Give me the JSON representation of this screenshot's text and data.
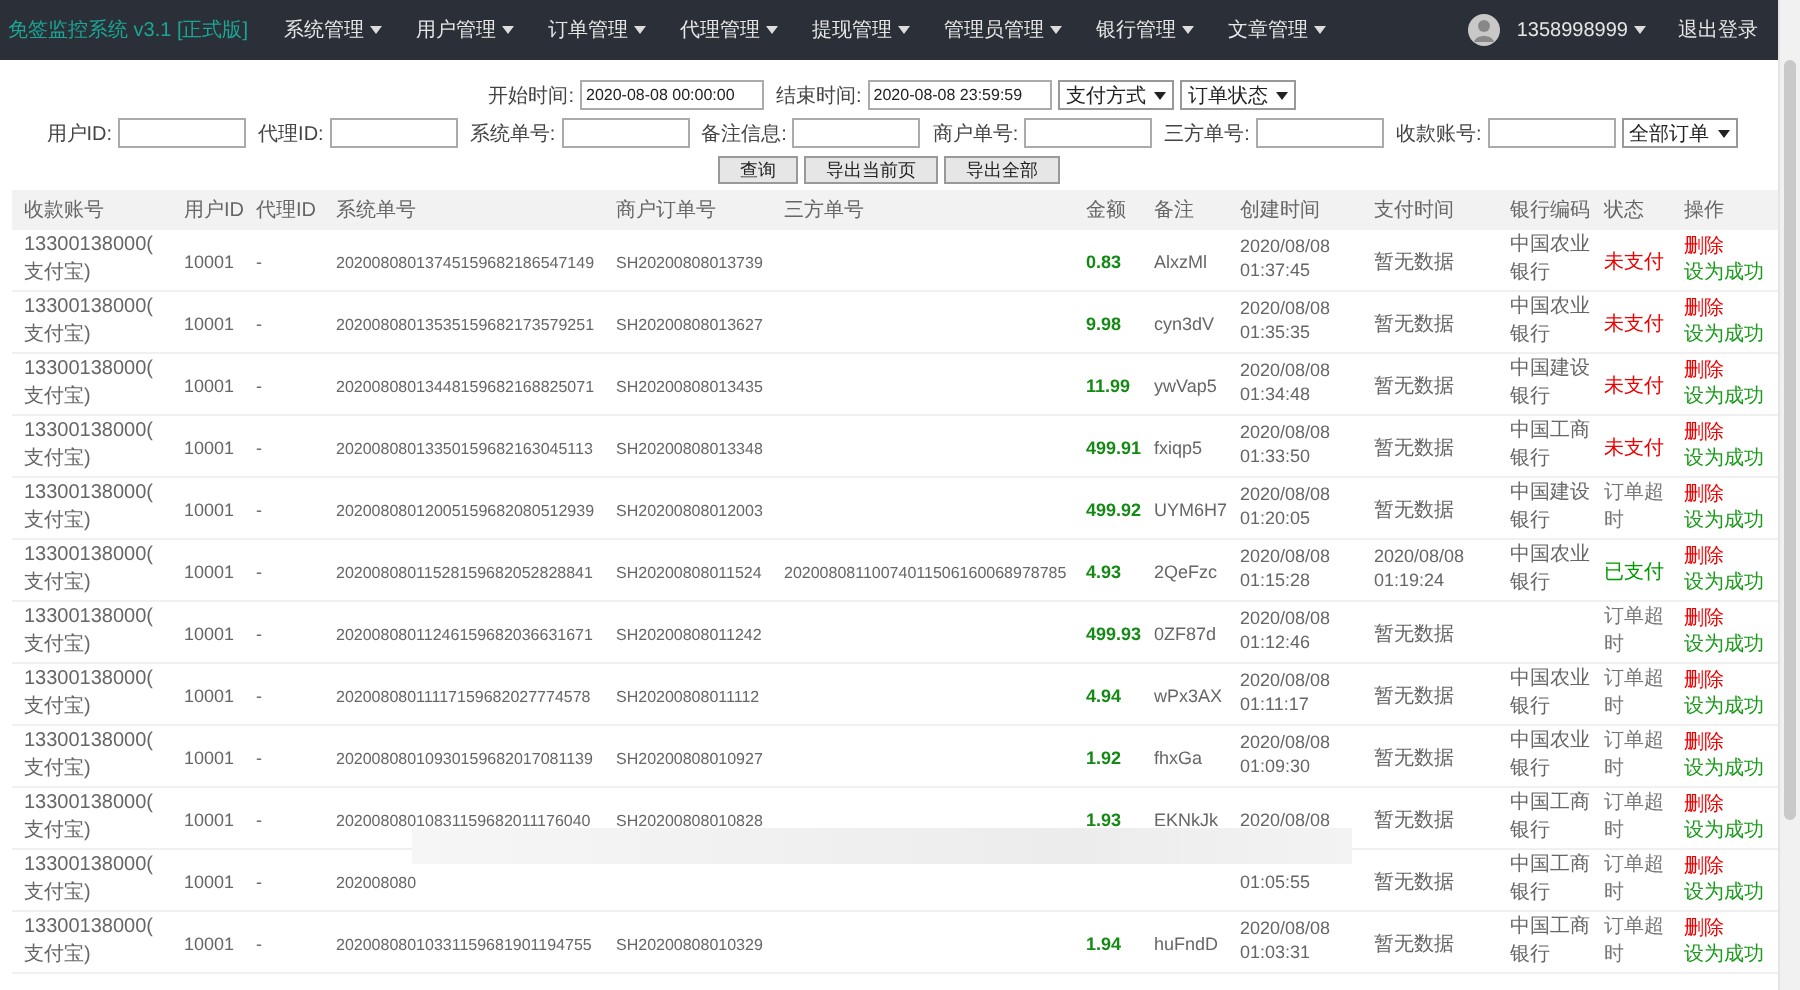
{
  "header": {
    "title": "免签监控系统 v3.1 [正式版]",
    "menu": [
      {
        "label": "系统管理"
      },
      {
        "label": "用户管理"
      },
      {
        "label": "订单管理"
      },
      {
        "label": "代理管理"
      },
      {
        "label": "提现管理"
      },
      {
        "label": "管理员管理"
      },
      {
        "label": "银行管理"
      },
      {
        "label": "文章管理"
      }
    ],
    "user": "1358998999",
    "logout": "退出登录"
  },
  "filters": {
    "row1": [
      {
        "kind": "input",
        "label": "开始时间:",
        "value": "2020-08-08 00:00:00"
      },
      {
        "kind": "input",
        "label": "结束时间:",
        "value": "2020-08-08 23:59:59"
      },
      {
        "kind": "select",
        "value": "支付方式"
      },
      {
        "kind": "select",
        "value": "订单状态"
      }
    ],
    "row2": [
      {
        "kind": "input",
        "label": "用户ID:"
      },
      {
        "kind": "input",
        "label": "代理ID:"
      },
      {
        "kind": "input",
        "label": "系统单号:"
      },
      {
        "kind": "input",
        "label": "备注信息:"
      },
      {
        "kind": "input",
        "label": "商户单号:"
      },
      {
        "kind": "input",
        "label": "三方单号:"
      },
      {
        "kind": "input",
        "label": "收款账号:"
      },
      {
        "kind": "select",
        "value": "全部订单"
      }
    ],
    "buttons": [
      "查询",
      "导出当前页",
      "导出全部"
    ]
  },
  "table": {
    "columns": [
      "收款账号",
      "用户ID",
      "代理ID",
      "系统单号",
      "商户订单号",
      "三方单号",
      "金额",
      "备注",
      "创建时间",
      "支付时间",
      "银行编码",
      "状态",
      "操作"
    ],
    "rows": [
      {
        "account": "13300138000(支付宝)",
        "user_id": "10001",
        "agent_id": "-",
        "sys_no": "20200808013745159682186547149",
        "merchant_no": "SH20200808013739",
        "amount": "0.83",
        "remark": "AlxzMl",
        "created": "2020/08/08 01:37:45",
        "paid": "暂无数据",
        "bank": "中国农业银行",
        "status": {
          "label": "未支付",
          "kind": "unpaid"
        },
        "actions": [
          "删除",
          "设为成功"
        ]
      },
      {
        "account": "13300138000(支付宝)",
        "user_id": "10001",
        "agent_id": "-",
        "sys_no": "20200808013535159682173579251",
        "merchant_no": "SH20200808013627",
        "amount": "9.98",
        "remark": "cyn3dV",
        "created": "2020/08/08 01:35:35",
        "paid": "暂无数据",
        "bank": "中国农业银行",
        "status": {
          "label": "未支付",
          "kind": "unpaid"
        },
        "actions": [
          "删除",
          "设为成功"
        ]
      },
      {
        "account": "13300138000(支付宝)",
        "user_id": "10001",
        "agent_id": "-",
        "sys_no": "20200808013448159682168825071",
        "merchant_no": "SH20200808013435",
        "amount": "11.99",
        "remark": "ywVap5",
        "created": "2020/08/08 01:34:48",
        "paid": "暂无数据",
        "bank": "中国建设银行",
        "status": {
          "label": "未支付",
          "kind": "unpaid"
        },
        "actions": [
          "删除",
          "设为成功"
        ]
      },
      {
        "account": "13300138000(支付宝)",
        "user_id": "10001",
        "agent_id": "-",
        "sys_no": "20200808013350159682163045113",
        "merchant_no": "SH20200808013348",
        "amount": "499.91",
        "remark": "fxiqp5",
        "created": "2020/08/08 01:33:50",
        "paid": "暂无数据",
        "bank": "中国工商银行",
        "status": {
          "label": "未支付",
          "kind": "unpaid"
        },
        "actions": [
          "删除",
          "设为成功"
        ]
      },
      {
        "account": "13300138000(支付宝)",
        "user_id": "10001",
        "agent_id": "-",
        "sys_no": "20200808012005159682080512939",
        "merchant_no": "SH20200808012003",
        "amount": "499.92",
        "remark": "UYM6H7",
        "created": "2020/08/08 01:20:05",
        "paid": "暂无数据",
        "bank": "中国建设银行",
        "status": {
          "label": "订单超时",
          "kind": "timeout"
        },
        "actions": [
          "删除",
          "设为成功"
        ]
      },
      {
        "account": "13300138000(支付宝)",
        "user_id": "10001",
        "agent_id": "-",
        "sys_no": "20200808011528159682052828841",
        "merchant_no": "SH20200808011524",
        "third_no": "20200808110074011506160068978785",
        "amount": "4.93",
        "remark": "2QeFzc",
        "created": "2020/08/08 01:15:28",
        "paid": "2020/08/08 01:19:24",
        "bank": "中国农业银行",
        "status": {
          "label": "已支付",
          "kind": "paid"
        },
        "actions": [
          "删除",
          "设为成功"
        ]
      },
      {
        "account": "13300138000(支付宝)",
        "user_id": "10001",
        "agent_id": "-",
        "sys_no": "20200808011246159682036631671",
        "merchant_no": "SH20200808011242",
        "amount": "499.93",
        "remark": "0ZF87d",
        "created": "2020/08/08 01:12:46",
        "paid": "暂无数据",
        "status": {
          "label": "订单超时",
          "kind": "timeout"
        },
        "actions": [
          "删除",
          "设为成功"
        ]
      },
      {
        "account": "13300138000(支付宝)",
        "user_id": "10001",
        "agent_id": "-",
        "sys_no": "20200808011117159682027774578",
        "merchant_no": "SH20200808011112",
        "amount": "4.94",
        "remark": "wPx3AX",
        "created": "2020/08/08 01:11:17",
        "paid": "暂无数据",
        "bank": "中国农业银行",
        "status": {
          "label": "订单超时",
          "kind": "timeout"
        },
        "actions": [
          "删除",
          "设为成功"
        ]
      },
      {
        "account": "13300138000(支付宝)",
        "user_id": "10001",
        "agent_id": "-",
        "sys_no": "20200808010930159682017081139",
        "merchant_no": "SH20200808010927",
        "amount": "1.92",
        "remark": "fhxGa",
        "created": "2020/08/08 01:09:30",
        "paid": "暂无数据",
        "bank": "中国农业银行",
        "status": {
          "label": "订单超时",
          "kind": "timeout"
        },
        "actions": [
          "删除",
          "设为成功"
        ]
      },
      {
        "account": "13300138000(支付宝)",
        "user_id": "10001",
        "agent_id": "-",
        "sys_no": "20200808010831159682011176040",
        "merchant_no": "SH20200808010828",
        "amount": "1.93",
        "remark": "EKNkJk",
        "created": "2020/08/08",
        "paid": "暂无数据",
        "bank": "中国工商银行",
        "status": {
          "label": "订单超时",
          "kind": "timeout"
        },
        "actions": [
          "删除",
          "设为成功"
        ]
      },
      {
        "account": "13300138000(支付宝)",
        "user_id": "10001",
        "agent_id": "-",
        "sys_no": "202008080",
        "created": "01:05:55",
        "paid": "暂无数据",
        "bank": "中国工商银行",
        "status": {
          "label": "订单超时",
          "kind": "timeout"
        },
        "actions": [
          "删除",
          "设为成功"
        ]
      },
      {
        "account": "13300138000(支付宝)",
        "user_id": "10001",
        "agent_id": "-",
        "sys_no": "20200808010331159681901194755",
        "merchant_no": "SH20200808010329",
        "amount": "1.94",
        "remark": "huFndD",
        "created": "2020/08/08 01:03:31",
        "paid": "暂无数据",
        "bank": "中国工商银行",
        "status": {
          "label": "订单超时",
          "kind": "timeout"
        },
        "actions": [
          "删除",
          "设为成功"
        ]
      }
    ]
  }
}
